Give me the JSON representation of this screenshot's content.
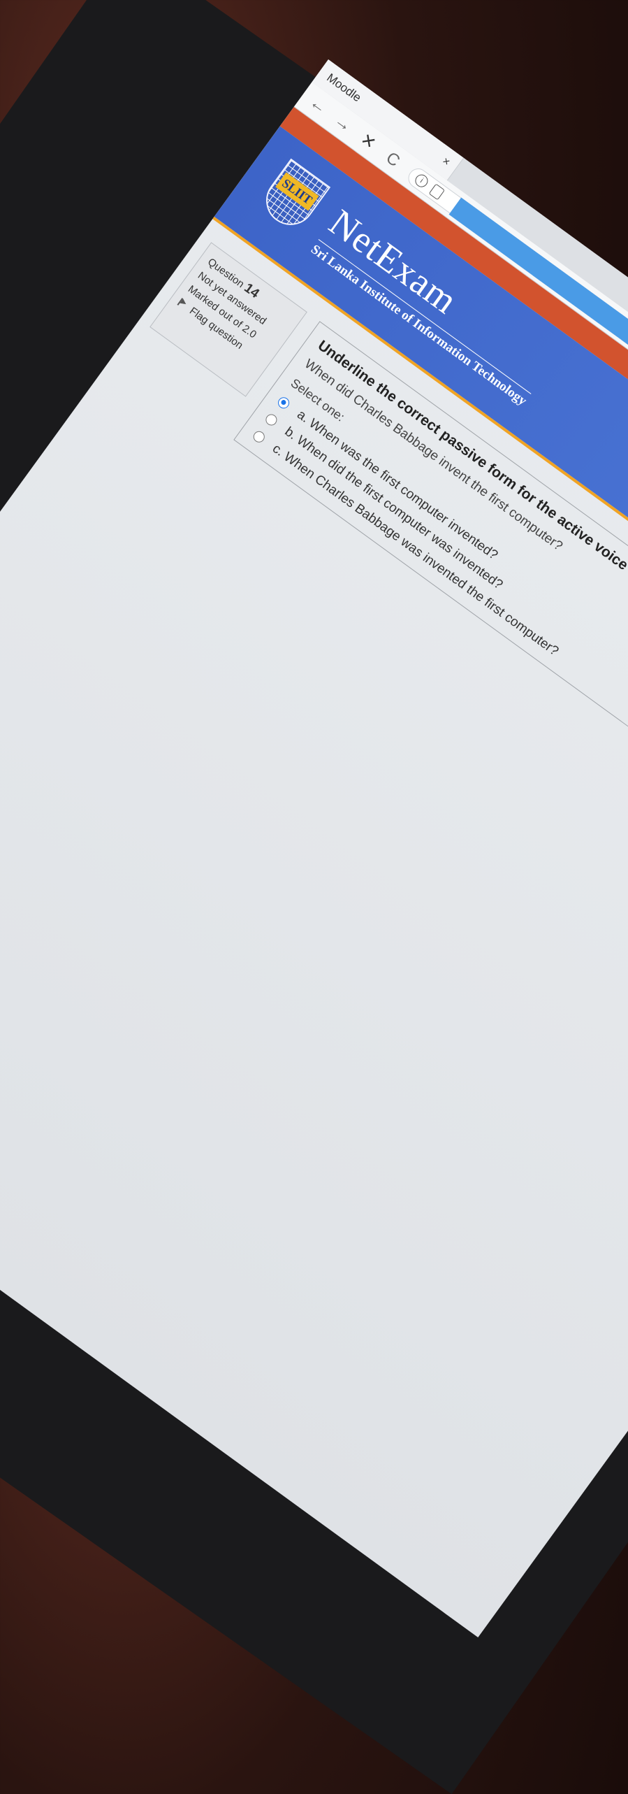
{
  "browser": {
    "tab_title": "Moodle",
    "tab_close": "×",
    "back_icon": "←",
    "forward_icon": "→",
    "stop_icon": "✕",
    "reload_icon": "C"
  },
  "header": {
    "logo_text": "SLIIT",
    "title": "NetExam",
    "subtitle": "Sri Lanka Institute of Information Technology",
    "colors": {
      "orange": "#d2532e",
      "blue": "#4a74d4",
      "gold": "#f0a324"
    }
  },
  "question_info": {
    "label": "Question",
    "number": "14",
    "status": "Not yet answered",
    "marks": "Marked out of 2.0",
    "flag_label": "Flag question"
  },
  "question": {
    "instruction": "Underline the correct passive form for the active voice sentence given below.",
    "sentence": "When did Charles Babbage invent the first computer?",
    "select_label": "Select one:",
    "options": [
      {
        "label": "a. When was the first computer invented?",
        "selected": true
      },
      {
        "label": "b. When did the first computer was invented?",
        "selected": false
      },
      {
        "label": "c. When Charles Babbage was invented the first computer?",
        "selected": false
      }
    ]
  }
}
